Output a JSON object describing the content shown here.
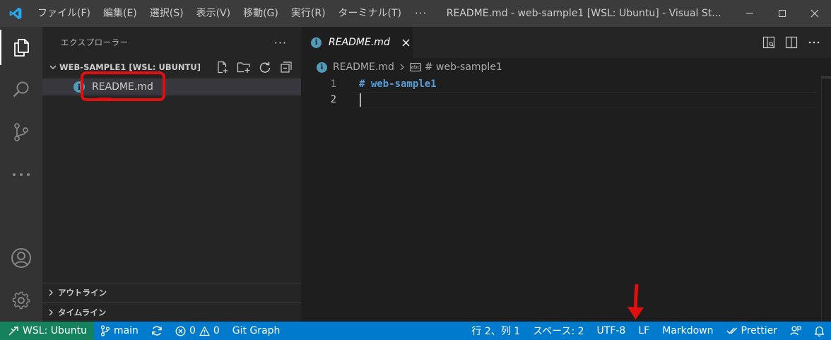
{
  "titlebar": {
    "menu": [
      "ファイル(F)",
      "編集(E)",
      "選択(S)",
      "表示(V)",
      "移動(G)",
      "実行(R)",
      "ターミナル(T)"
    ],
    "more": "···",
    "title": "README.md - web-sample1 [WSL: Ubuntu] - Visual St..."
  },
  "sidebar": {
    "title": "エクスプローラー",
    "more": "···",
    "folder": "WEB-SAMPLE1 [WSL: UBUNTU]",
    "file": "README.md",
    "sections": [
      "アウトライン",
      "タイムライン"
    ]
  },
  "editor": {
    "tab_label": "README.md",
    "breadcrumb": {
      "file": "README.md",
      "symbol": "# web-sample1",
      "symbol_icon": "abc"
    },
    "lines": [
      {
        "number": "1",
        "text": "# web-sample1"
      },
      {
        "number": "2",
        "text": ""
      }
    ]
  },
  "statusbar": {
    "remote": "WSL: Ubuntu",
    "branch": "main",
    "errors": "0",
    "warnings": "0",
    "git_graph": "Git Graph",
    "position": "行 2、列 1",
    "indent": "スペース: 2",
    "encoding": "UTF-8",
    "eol": "LF",
    "language": "Markdown",
    "prettier": "Prettier"
  },
  "colors": {
    "statusbar": "#007acc",
    "remote": "#16825d",
    "annotation": "#e01010",
    "heading": "#569cd6"
  }
}
